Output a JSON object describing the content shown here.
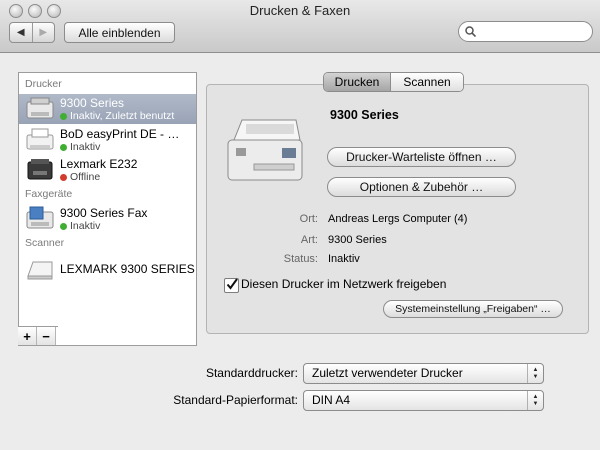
{
  "window": {
    "title": "Drucken & Faxen"
  },
  "toolbar": {
    "back_glyph": "◀",
    "forward_glyph": "▶",
    "show_all": "Alle einblenden",
    "search_placeholder": ""
  },
  "sidebar": {
    "section_printers": "Drucker",
    "section_fax": "Faxgeräte",
    "section_scanner": "Scanner",
    "items": [
      {
        "name": "9300 Series",
        "status": "Inaktiv, Zuletzt benutzt",
        "status_color": "#3fae32",
        "icon": "multifunction-printer-icon",
        "selected": true
      },
      {
        "name": "BoD easyPrint DE - …",
        "status": "Inaktiv",
        "status_color": "#3fae32",
        "icon": "pdf-printer-icon"
      },
      {
        "name": "Lexmark E232",
        "status": "Offline",
        "status_color": "#d23c2c",
        "icon": "laser-printer-icon"
      },
      {
        "name": "9300 Series Fax",
        "status": "Inaktiv",
        "status_color": "#3fae32",
        "icon": "fax-icon"
      },
      {
        "name": "LEXMARK 9300 SERIES",
        "status": "",
        "icon": "scanner-icon"
      }
    ],
    "add_glyph": "+",
    "remove_glyph": "−"
  },
  "tabs": {
    "print": "Drucken",
    "scan": "Scannen",
    "active": "print"
  },
  "detail": {
    "name": "9300 Series",
    "queue_button": "Drucker-Warteliste öffnen …",
    "options_button": "Optionen & Zubehör …",
    "location_label": "Ort:",
    "location_value": "Andreas Lergs Computer (4)",
    "kind_label": "Art:",
    "kind_value": "9300 Series",
    "status_label": "Status:",
    "status_value": "Inaktiv",
    "share_label": "Diesen Drucker im Netzwerk freigeben",
    "share_checked": true,
    "sharing_prefs_button": "Systemeinstellung „Freigaben“ …"
  },
  "defaults": {
    "printer_label": "Standarddrucker:",
    "printer_value": "Zuletzt verwendeter Drucker",
    "paper_label": "Standard-Papierformat:",
    "paper_value": "DIN A4"
  },
  "colors": {
    "selection": "#98a3b6",
    "status_ok": "#3fae32",
    "status_offline": "#d23c2c"
  }
}
